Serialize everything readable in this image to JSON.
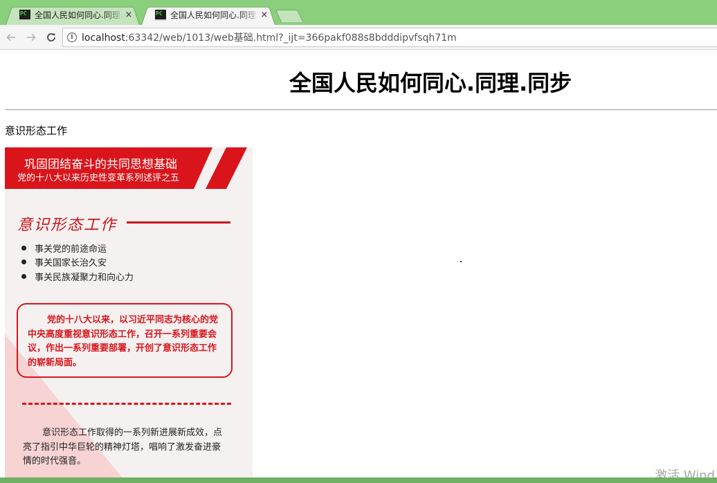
{
  "browser": {
    "tabs": [
      {
        "title": "全国人民如何同心.同理.同步",
        "icon": "pycharm-icon",
        "close": "×",
        "active": false
      },
      {
        "title": "全国人民如何同心.同理.同步",
        "icon": "pycharm-icon",
        "close": "×",
        "active": true
      }
    ],
    "pc_icon_text": "PC",
    "url_host": "localhost",
    "url_rest": ":63342/web/1013/web基础.html?_ijt=366pakf088s8bdddipvfsqh71m",
    "info_icon_text": "i"
  },
  "page": {
    "heading": "全国人民如何同心.同理.同步",
    "subtitle": "意识形态工作"
  },
  "poster": {
    "banner_title": "巩固团结奋斗的共同思想基础",
    "banner_subtitle": "党的十八大以来历史性变革系列述评之五",
    "calligraphy_title": "意识形态工作",
    "bullets": [
      "事关党的前途命运",
      "事关国家长治久安",
      "事关民族凝聚力和向心力"
    ],
    "box_text": "党的十八大以来，以习近平同志为核心的党中央高度重视意识形态工作，召开一系列重要会议，作出一系列重要部署，开创了意识形态工作的崭新局面。",
    "bottom_text": "意识形态工作取得的一系列新进展新成效，点亮了指引中华巨轮的精神灯塔，唱响了激发奋进豪情的时代强音。",
    "accent_color": "#d9151b"
  },
  "os": {
    "watermark": "激活 Wind"
  }
}
